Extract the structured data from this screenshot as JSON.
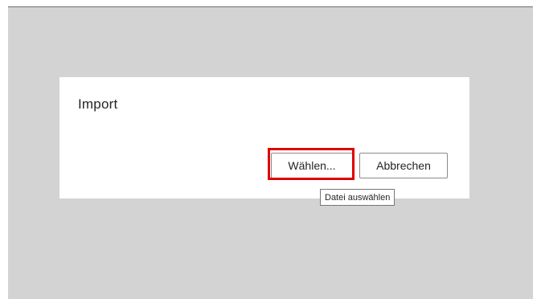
{
  "dialog": {
    "title": "Import",
    "choose_button_label": "Wählen...",
    "cancel_button_label": "Abbrechen"
  },
  "tooltip": {
    "text": "Datei auswählen"
  },
  "colors": {
    "overlay": "#d3d3d3",
    "dialog_background": "#ffffff",
    "highlight_border": "#e00000",
    "button_border": "#8a8a8a"
  }
}
